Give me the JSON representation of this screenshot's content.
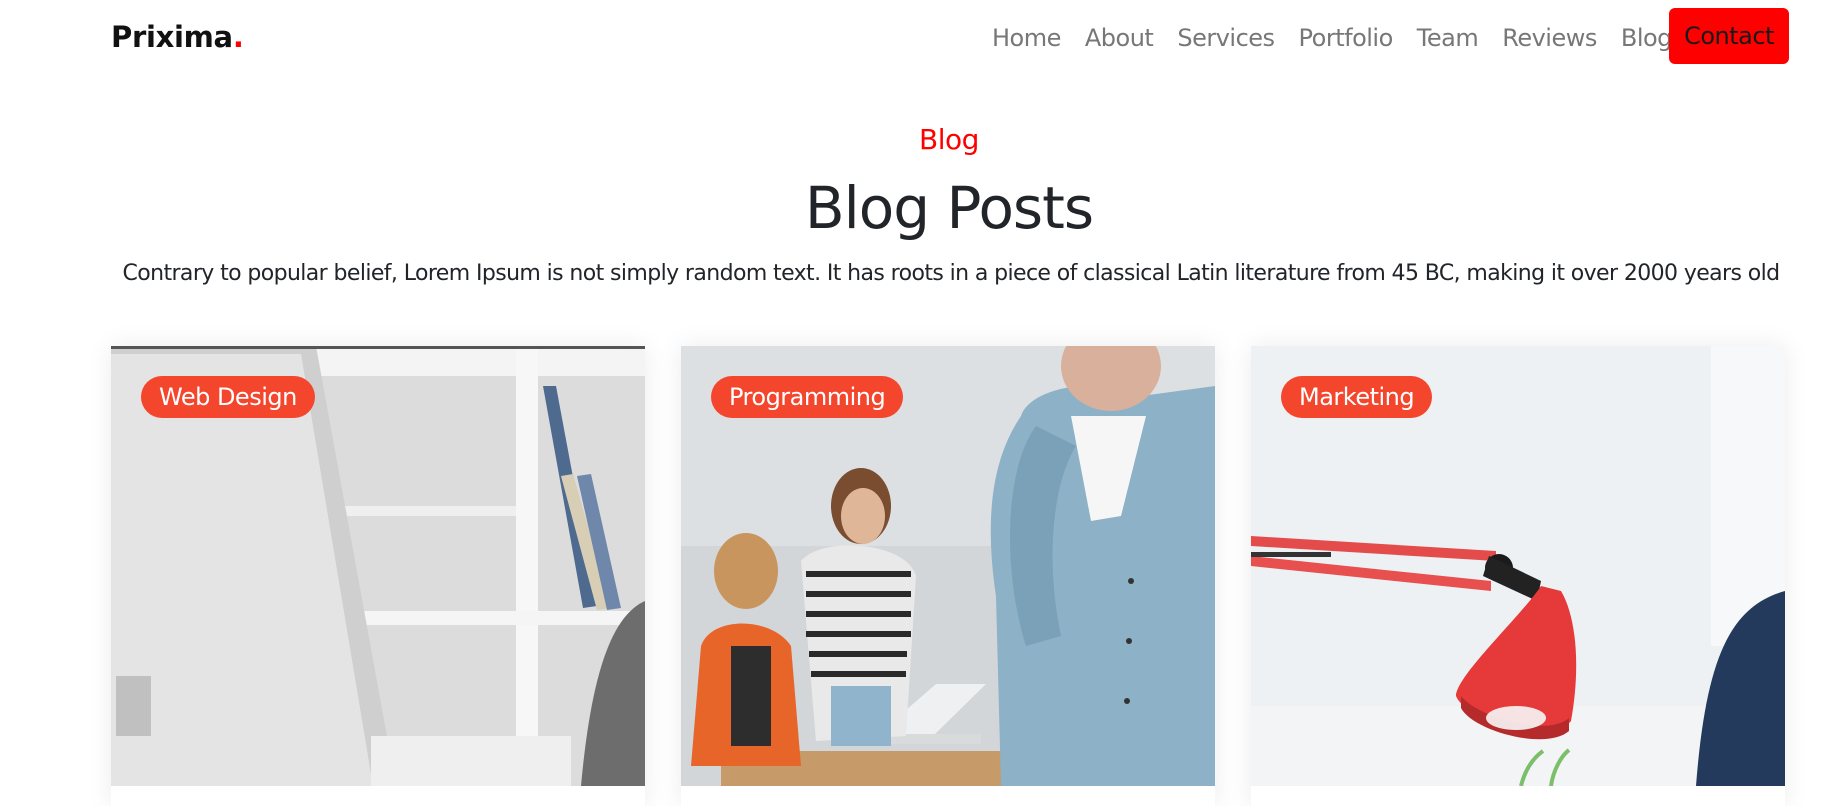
{
  "brand": {
    "name": "Prixima",
    "dot": "."
  },
  "nav": {
    "items": [
      {
        "label": "Home"
      },
      {
        "label": "About"
      },
      {
        "label": "Services"
      },
      {
        "label": "Portfolio"
      },
      {
        "label": "Team"
      },
      {
        "label": "Reviews"
      },
      {
        "label": "Blog"
      }
    ],
    "contact_label": "Contact"
  },
  "section": {
    "tag": "Blog",
    "title": "Blog Posts",
    "description": "Contrary to popular belief, Lorem Ipsum is not simply random text. It has roots in a piece of classical Latin literature from 45 BC, making it over 2000 years old"
  },
  "posts": [
    {
      "category": "Web Design"
    },
    {
      "category": "Programming"
    },
    {
      "category": "Marketing"
    }
  ],
  "colors": {
    "accent": "#ff0000",
    "badge": "#f4452d",
    "text": "#212529",
    "nav_text": "#777777"
  }
}
